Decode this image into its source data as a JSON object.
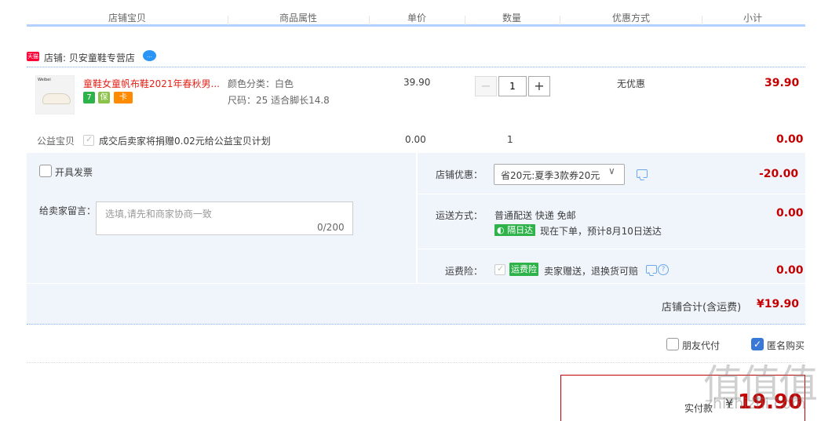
{
  "header": {
    "cols": [
      "店铺宝贝",
      "商品属性",
      "单价",
      "数量",
      "优惠方式",
      "小计"
    ]
  },
  "shop": {
    "badge": "天猫",
    "label": "店铺: 贝安童鞋专营店",
    "ww_icon": "wangwang-chat-icon"
  },
  "item": {
    "thumb_brand": "Weibei",
    "title": "童鞋女童帆布鞋2021年春秋男...",
    "tags": [
      {
        "text": "7",
        "color": "#2eb34a",
        "icon": "seven-day-return-icon"
      },
      {
        "text": "保",
        "color": "#8bc34a",
        "icon": "guarantee-icon"
      },
      {
        "text": "卡",
        "color": "#ff8a00",
        "icon": "card-pay-icon"
      }
    ],
    "attr_color": "颜色分类：白色",
    "attr_size": "尺码：25 适合脚长14.8",
    "price": "39.90",
    "qty": "1",
    "discount": "无优惠",
    "subtotal": "39.90"
  },
  "charity": {
    "label": "公益宝贝",
    "text": "成交后卖家将捐赠0.02元给公益宝贝计划",
    "price": "0.00",
    "qty": "1",
    "subtotal": "0.00"
  },
  "invoice": {
    "label": "开具发票"
  },
  "message": {
    "label": "给卖家留言：",
    "placeholder": "选填,请先和商家协商一致",
    "count": "0/200"
  },
  "coupon": {
    "label": "店铺优惠：",
    "value": "省20元:夏季3款券20元",
    "amount": "-20.00"
  },
  "shipping": {
    "label": "运送方式：",
    "method": "普通配送 快递 免邮",
    "badge": "隔日达",
    "eta": "现在下单，预计8月10日送达",
    "amount": "0.00"
  },
  "insurance": {
    "label": "运费险：",
    "badge": "运费险",
    "text": "卖家赠送，退换货可赔",
    "amount": "0.00"
  },
  "shop_total": {
    "label": "店铺合计(含运费)",
    "value": "¥19.90"
  },
  "options": {
    "friend_pay": "朋友代付",
    "anonymous": "匿名购买",
    "anonymous_checked": true
  },
  "pay": {
    "label": "实付款",
    "yen": "¥",
    "value": "19.90"
  },
  "watermark": {
    "text": "值值值",
    "url": "zhizhizhi.com"
  }
}
